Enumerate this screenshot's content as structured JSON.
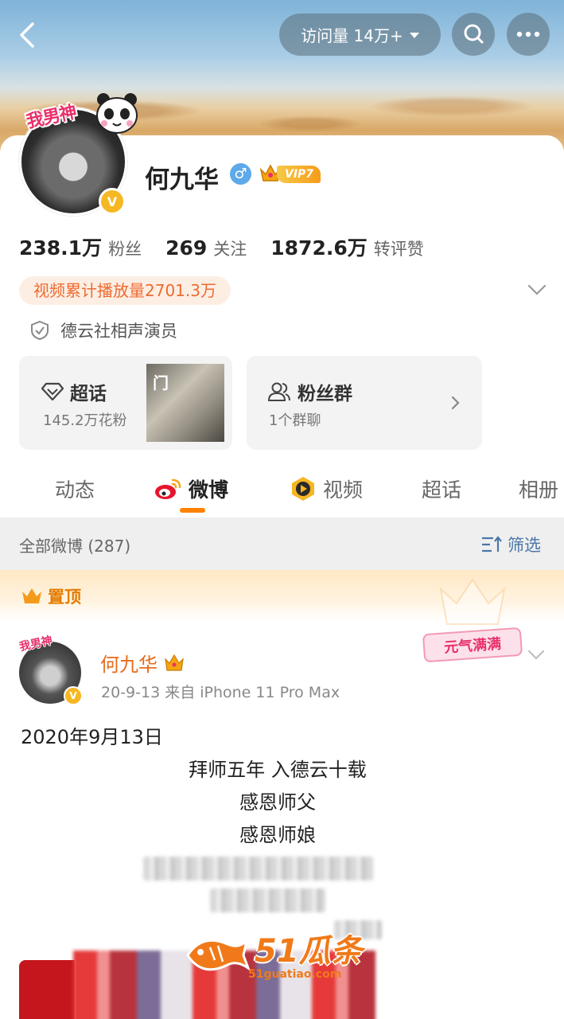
{
  "header": {
    "visit_label": "访问量 14万+"
  },
  "profile": {
    "avatar_sticker": "我男神",
    "name": "何九华",
    "gender_symbol": "♂",
    "vip_label": "VIP7",
    "verified_mark": "V",
    "stats": [
      {
        "value": "238.1万",
        "label": "粉丝"
      },
      {
        "value": "269",
        "label": "关注"
      },
      {
        "value": "1872.6万",
        "label": "转评赞"
      }
    ],
    "play_count": "视频累计播放量2701.3万",
    "certification": "德云社相声演员"
  },
  "tiles": {
    "super_topic": {
      "title": "超话",
      "sub": "145.2万花粉",
      "thumb_text": "门"
    },
    "fan_group": {
      "title": "粉丝群",
      "sub": "1个群聊"
    }
  },
  "tabs": [
    {
      "label": "动态"
    },
    {
      "label": "微博"
    },
    {
      "label": "视频"
    },
    {
      "label": "超话"
    },
    {
      "label": "相册"
    }
  ],
  "filter": {
    "count_label": "全部微博 (287)",
    "filter_label": "筛选"
  },
  "post": {
    "pinned_label": "置顶",
    "avatar_sticker": "我男神",
    "author": "何九华",
    "meta": "20-9-13  来自 iPhone 11 Pro Max",
    "sticker_tag": "元气满满",
    "lines": [
      "2020年9月13日",
      "拜师五年   入德云十载",
      "感恩师父",
      "感恩师娘"
    ]
  },
  "watermark": {
    "brand": "51瓜条",
    "url": "51guatiao.com"
  },
  "colors": {
    "accent_orange": "#ff8200",
    "vip_gold": "#f6b822",
    "link_blue": "#4a76a8"
  }
}
